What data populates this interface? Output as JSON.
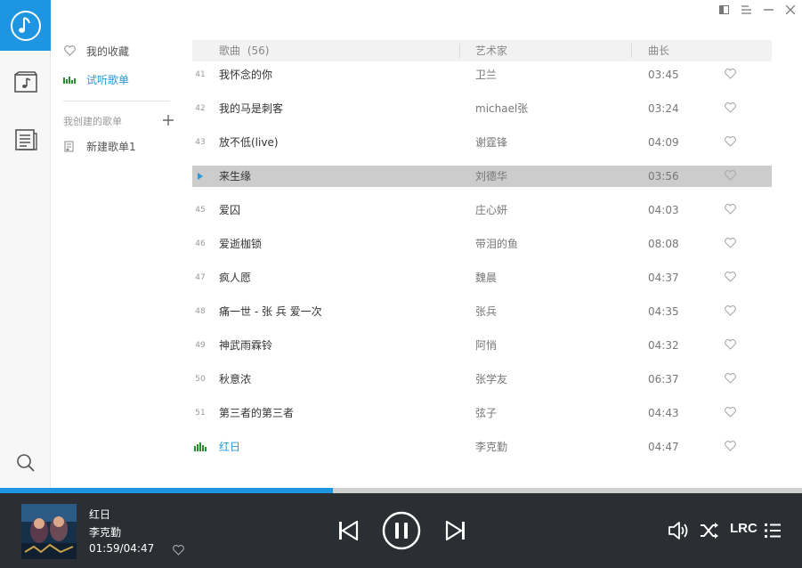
{
  "colors": {
    "accent": "#1d95e0",
    "playing": "#2a9ad9",
    "player_bg": "#2b2e33",
    "selected_row": "#cccccc"
  },
  "sidebar": {
    "items": [
      {
        "label": "我的收藏",
        "icon": "heart-icon"
      },
      {
        "label": "试听歌单",
        "icon": "equalizer-icon"
      }
    ],
    "section_label": "我创建的歌单",
    "add_icon": "plus-icon",
    "playlists": [
      {
        "label": "新建歌单1",
        "icon": "playlist-icon"
      }
    ]
  },
  "rail": {
    "icons": [
      "music-note-logo-icon",
      "music-folder-icon",
      "list-document-icon",
      "search-icon"
    ]
  },
  "window_controls": [
    "mini-mode-icon",
    "menu-icon",
    "minimize-icon",
    "close-icon"
  ],
  "table": {
    "header": {
      "title": "歌曲",
      "count": "(56)",
      "artist": "艺术家",
      "duration": "曲长"
    },
    "rows": [
      {
        "num": "41",
        "title": "我怀念的你",
        "artist": "卫兰",
        "duration": "03:45"
      },
      {
        "num": "42",
        "title": "我的马是刺客",
        "artist": "michael张",
        "duration": "03:24"
      },
      {
        "num": "43",
        "title": "放不低(live)",
        "artist": "谢霆锋",
        "duration": "04:09"
      },
      {
        "num": "",
        "title": "来生缘",
        "artist": "刘德华",
        "duration": "03:56",
        "state": "selected"
      },
      {
        "num": "45",
        "title": "爱囚",
        "artist": "庄心妍",
        "duration": "04:03"
      },
      {
        "num": "46",
        "title": "爱逝枷锁",
        "artist": "带泪的鱼",
        "duration": "08:08"
      },
      {
        "num": "47",
        "title": "疯人愿",
        "artist": "魏晨",
        "duration": "04:37"
      },
      {
        "num": "48",
        "title": "痛一世 - 张 兵 爱一次",
        "artist": "张兵",
        "duration": "04:35"
      },
      {
        "num": "49",
        "title": "神武雨霖铃",
        "artist": "阿悄",
        "duration": "04:32"
      },
      {
        "num": "50",
        "title": "秋意浓",
        "artist": "张学友",
        "duration": "06:37"
      },
      {
        "num": "51",
        "title": "第三者的第三者",
        "artist": "弦子",
        "duration": "04:43"
      },
      {
        "num": "",
        "title": "红日",
        "artist": "李克勤",
        "duration": "04:47",
        "state": "playing"
      }
    ]
  },
  "player": {
    "title": "红日",
    "artist": "李克勤",
    "time": "01:59/04:47",
    "progress": 0.415,
    "lrc_label": "LRC",
    "icons": [
      "previous-icon",
      "pause-icon",
      "next-icon",
      "volume-icon",
      "shuffle-icon",
      "playlist-queue-icon"
    ]
  }
}
